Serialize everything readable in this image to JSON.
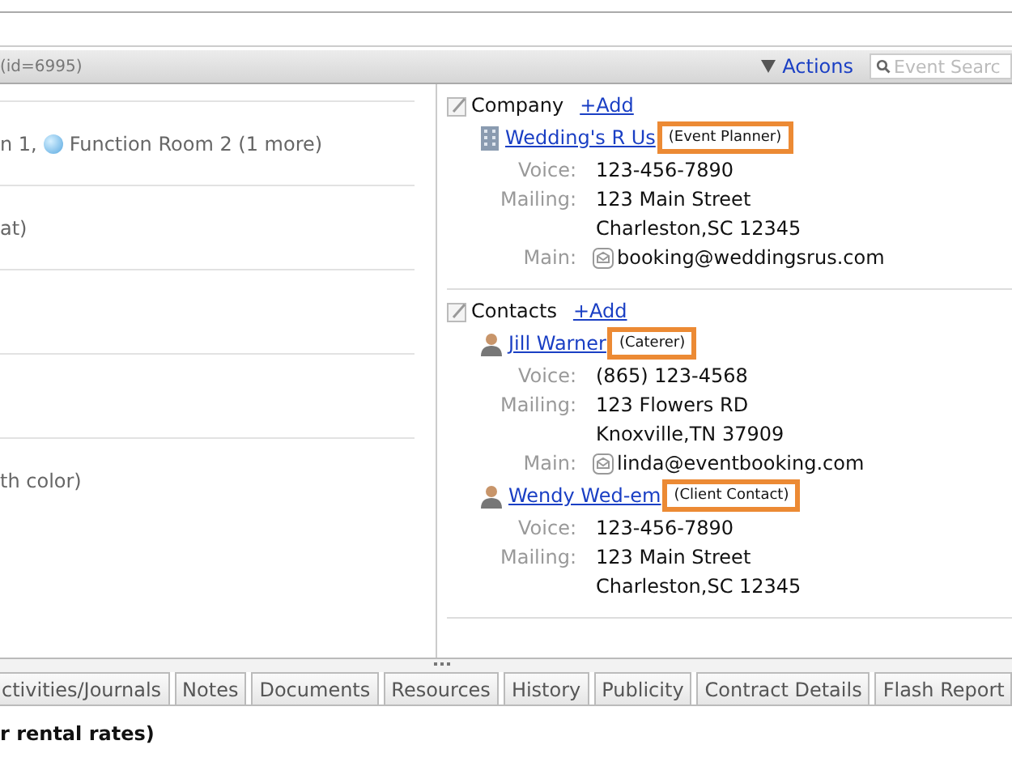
{
  "header": {
    "record_id": "(id=6995)",
    "actions": "Actions",
    "search": {
      "placeholder": "Event Searc"
    }
  },
  "left_rows": [
    {
      "parts": [
        {
          "kind": "text",
          "text": "n 1,"
        },
        {
          "kind": "room",
          "text": "Function Room 2 (1 more)"
        }
      ]
    },
    {
      "parts": [
        {
          "kind": "text",
          "text": "at)"
        }
      ]
    },
    {
      "parts": []
    },
    {
      "parts": []
    },
    {
      "parts": [
        {
          "kind": "text",
          "text": "th color)"
        }
      ]
    }
  ],
  "company": {
    "title": "Company",
    "add": "+Add",
    "entries": [
      {
        "name": "Wedding's R Us",
        "role": "(Event Planner)",
        "fields": [
          {
            "label": "Voice:",
            "value": "123-456-7890"
          },
          {
            "label": "Mailing:",
            "value": "123 Main Street"
          },
          {
            "value": "Charleston,SC 12345"
          },
          {
            "label": "Main:",
            "value": "booking@weddingsrus.com",
            "kind": "email"
          }
        ]
      }
    ]
  },
  "contacts": {
    "title": "Contacts",
    "add": "+Add",
    "entries": [
      {
        "name": "Jill Warner",
        "role": "(Caterer)",
        "fields": [
          {
            "label": "Voice:",
            "value": "(865) 123-4568"
          },
          {
            "label": "Mailing:",
            "value": "123 Flowers RD"
          },
          {
            "value": "Knoxville,TN 37909"
          },
          {
            "label": "Main:",
            "value": "linda@eventbooking.com",
            "kind": "email"
          }
        ]
      },
      {
        "name": "Wendy Wed-em",
        "role": "(Client Contact)",
        "fields": [
          {
            "label": "Voice:",
            "value": "123-456-7890"
          },
          {
            "label": "Mailing:",
            "value": "123 Main Street"
          },
          {
            "value": "Charleston,SC 12345"
          }
        ]
      }
    ]
  },
  "tabs": [
    "ctivities/Journals",
    "Notes",
    "Documents",
    "Resources",
    "History",
    "Publicity",
    "Contract Details",
    "Flash Report"
  ],
  "bottom_text": "r rental rates)"
}
